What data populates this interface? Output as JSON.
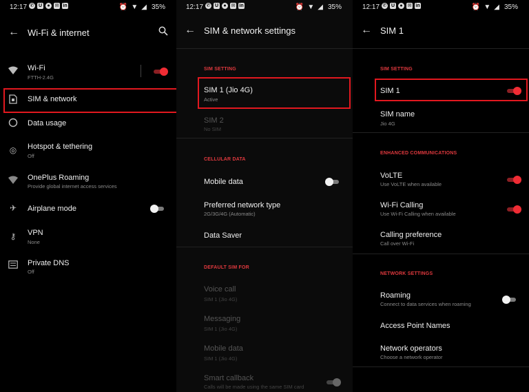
{
  "status_bar": {
    "time": "12:17",
    "battery": "35%"
  },
  "panel1": {
    "title": "Wi-Fi & internet",
    "items": [
      {
        "title": "Wi-Fi",
        "subtitle": "FTTH-2.4G",
        "icon": "wifi-icon",
        "toggle": "on"
      },
      {
        "title": "SIM & network",
        "subtitle": "",
        "icon": "sim-card-icon"
      },
      {
        "title": "Data usage",
        "subtitle": "",
        "icon": "data-usage-icon"
      },
      {
        "title": "Hotspot & tethering",
        "subtitle": "Off",
        "icon": "hotspot-icon"
      },
      {
        "title": "OnePlus Roaming",
        "subtitle": "Provide global internet access services",
        "icon": "roaming-icon"
      },
      {
        "title": "Airplane mode",
        "subtitle": "",
        "icon": "airplane-icon",
        "toggle": "off"
      },
      {
        "title": "VPN",
        "subtitle": "None",
        "icon": "vpn-key-icon"
      },
      {
        "title": "Private DNS",
        "subtitle": "Off",
        "icon": "dns-icon"
      }
    ]
  },
  "panel2": {
    "title": "SIM & network settings",
    "sections": {
      "sim_setting": "SIM SETTING",
      "cellular_data": "CELLULAR DATA",
      "default_sim": "DEFAULT SIM FOR"
    },
    "sim1": {
      "title": "SIM 1  (Jio 4G)",
      "subtitle": "Active"
    },
    "sim2": {
      "title": "SIM 2",
      "subtitle": "No SIM"
    },
    "mobile_data": {
      "title": "Mobile data",
      "toggle": "off"
    },
    "preferred_network": {
      "title": "Preferred network type",
      "subtitle": "2G/3G/4G (Automatic)"
    },
    "data_saver": {
      "title": "Data Saver"
    },
    "voice_call": {
      "title": "Voice call",
      "subtitle": "SIM 1  (Jio 4G)"
    },
    "messaging": {
      "title": "Messaging",
      "subtitle": "SIM 1  (Jio 4G)"
    },
    "mobile_data_default": {
      "title": "Mobile data",
      "subtitle": "SIM 1  (Jio 4G)"
    },
    "smart_callback": {
      "title": "Smart callback",
      "subtitle": "Calls will be made using the same SIM card"
    }
  },
  "panel3": {
    "title": "SIM 1",
    "sections": {
      "sim_setting": "SIM SETTING",
      "enhanced": "ENHANCED COMMUNICATIONS",
      "network": "NETWORK SETTINGS"
    },
    "sim1": {
      "title": "SIM 1",
      "toggle": "on"
    },
    "sim_name": {
      "title": "SIM name",
      "subtitle": "Jio 4G"
    },
    "volte": {
      "title": "VoLTE",
      "subtitle": "Use VoLTE when available",
      "toggle": "on"
    },
    "wifi_calling": {
      "title": "Wi-Fi Calling",
      "subtitle": "Use Wi-Fi Calling when available",
      "toggle": "on"
    },
    "calling_pref": {
      "title": "Calling preference",
      "subtitle": "Call over Wi-Fi"
    },
    "roaming": {
      "title": "Roaming",
      "subtitle": "Connect to data services when roaming",
      "toggle": "off"
    },
    "apn": {
      "title": "Access Point Names"
    },
    "operators": {
      "title": "Network operators",
      "subtitle": "Choose a network operator"
    }
  },
  "colors": {
    "accent": "#e0393e",
    "highlight": "#e3181f",
    "background": "#000000"
  }
}
